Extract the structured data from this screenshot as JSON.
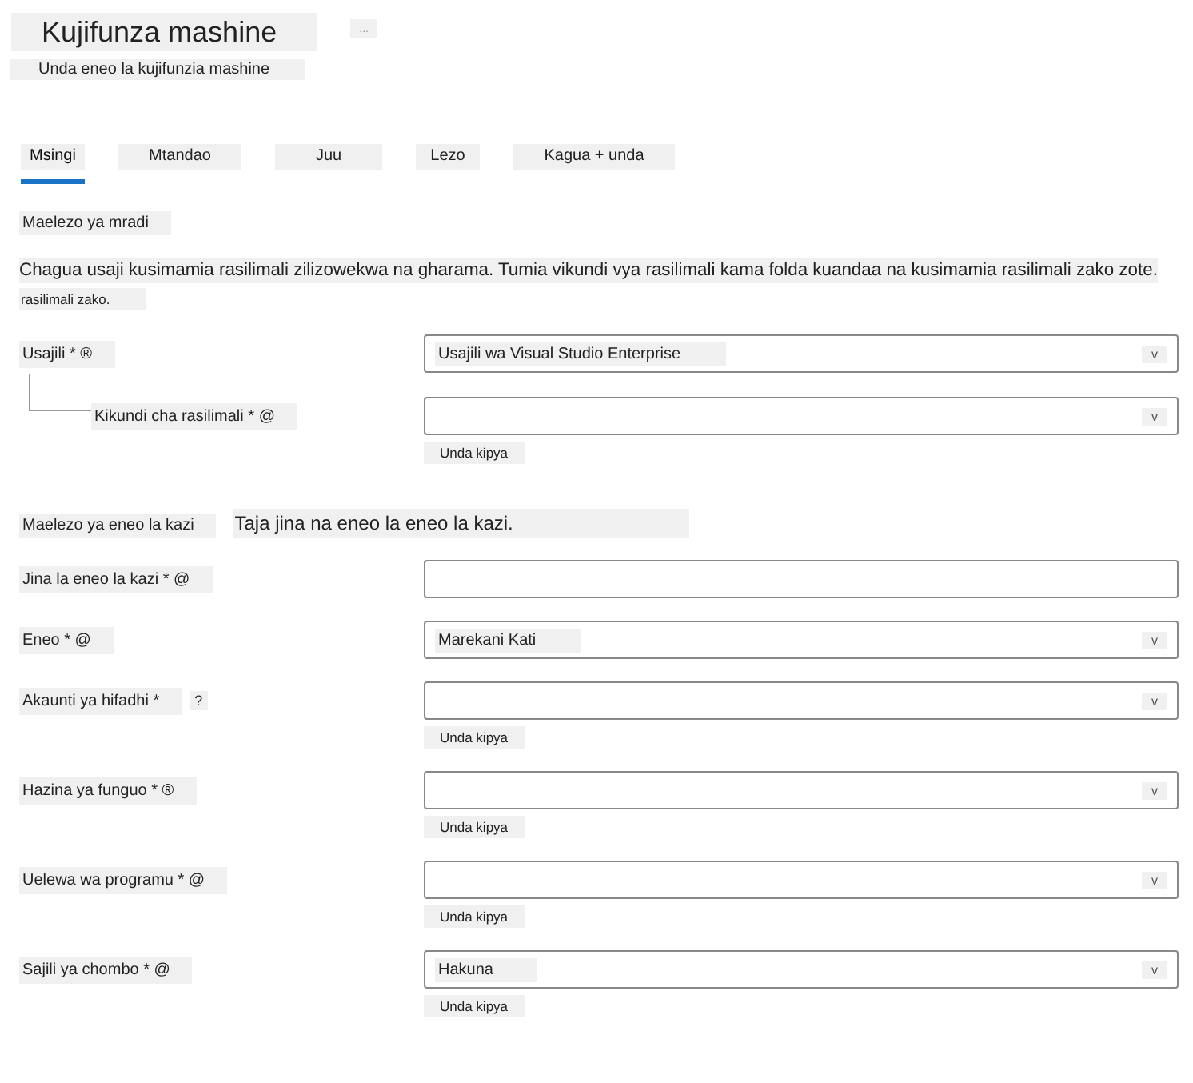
{
  "header": {
    "title": "Kujifunza mashine",
    "more_button": "...",
    "subtitle": "Unda eneo la kujifunzia mashine"
  },
  "tabs": [
    {
      "label": "Msingi",
      "selected": true
    },
    {
      "label": "Mtandao",
      "selected": false
    },
    {
      "label": "Juu",
      "selected": false
    },
    {
      "label": "Lezo",
      "selected": false
    },
    {
      "label": "Kagua + unda",
      "selected": false
    }
  ],
  "sections": [
    {
      "heading": "Maelezo ya mradi",
      "description": "Chagua usaji kusimamia rasilimali zilizowekwa na gharama. Tumia vikundi vya rasilimali kama folda kuandaa na kusimamia rasilimali zako zote.",
      "description_continued": "rasilimali zako.",
      "fields": [
        {
          "label": "Usajili * ®",
          "kind": "dropdown",
          "nested": false,
          "value": "Usajili wa Visual Studio Enterprise",
          "chevron": "v"
        },
        {
          "label": "Kikundi cha rasilimali * @",
          "kind": "dropdown",
          "nested": true,
          "chevron": "v",
          "create_link": "Unda kipya"
        }
      ]
    },
    {
      "heading": "Maelezo ya eneo la kazi",
      "description": "Taja jina na eneo la eneo la kazi.",
      "fields": [
        {
          "label": "Jina la eneo la kazi * @",
          "kind": "text",
          "nested": false
        },
        {
          "label": "Eneo * @",
          "kind": "dropdown",
          "nested": false,
          "value": "Marekani Kati",
          "chevron": "v"
        },
        {
          "label": "Akaunti ya hifadhi *",
          "help": "?",
          "kind": "dropdown",
          "nested": false,
          "chevron": "v",
          "create_link": "Unda kipya"
        },
        {
          "label": "Hazina ya funguo * ®",
          "kind": "dropdown",
          "nested": false,
          "chevron": "v",
          "create_link": "Unda kipya"
        },
        {
          "label": "Uelewa wa programu * @",
          "kind": "dropdown",
          "nested": false,
          "chevron": "v",
          "create_link": "Unda kipya"
        },
        {
          "label": "Sajili ya chombo * @",
          "kind": "dropdown",
          "nested": false,
          "value": "Hakuna",
          "chevron": "v",
          "create_link": "Unda kipya"
        }
      ]
    }
  ]
}
